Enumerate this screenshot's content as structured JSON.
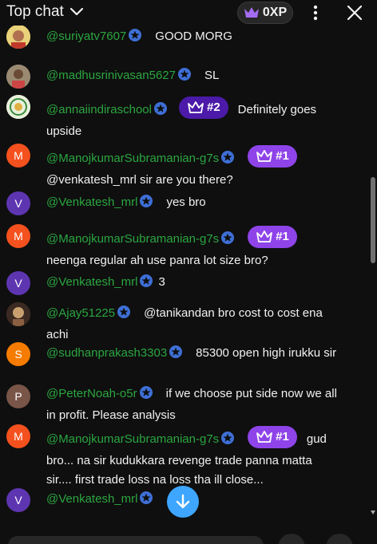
{
  "header": {
    "title": "Top chat",
    "xp_label": "0XP"
  },
  "colors": {
    "author": "#2ba640",
    "badge_primary": "#8e44e9",
    "badge_secondary": "#4b1aa8",
    "accent": "#3ea6ff"
  },
  "messages": [
    {
      "author": "@suriyatv7607",
      "text": "GOOD MORG",
      "avatar_letter": ""
    },
    {
      "author": "@madhusrinivasan5627",
      "text": "SL",
      "avatar_letter": ""
    },
    {
      "author": "@annaiindiraschool",
      "badge": "#2",
      "text": "Definitely goes upside",
      "avatar_letter": ""
    },
    {
      "author": "@ManojkumarSubramanian-g7s",
      "badge": "#1",
      "text": "@venkatesh_mrl sir are you there?",
      "avatar_letter": "M"
    },
    {
      "author": "@Venkatesh_mrl",
      "text": "yes bro",
      "avatar_letter": "V"
    },
    {
      "author": "@ManojkumarSubramanian-g7s",
      "badge": "#1",
      "text": "neenga regular ah use panra lot size bro?",
      "avatar_letter": "M"
    },
    {
      "author": "@Venkatesh_mrl",
      "text": "3",
      "avatar_letter": "V"
    },
    {
      "author": "@Ajay51225",
      "text": "@tanikandan bro cost to cost ena achi",
      "avatar_letter": ""
    },
    {
      "author": "@sudhanprakash3303",
      "text": "85300 open high irukku sir",
      "avatar_letter": "S"
    },
    {
      "author": "@PeterNoah-o5r",
      "text": "if we choose put side now we all in profit. Please analysis",
      "avatar_letter": "P"
    },
    {
      "author": "@ManojkumarSubramanian-g7s",
      "badge": "#1",
      "text": "gud bro... na sir kudukkara revenge trade panna matta sir.... first trade loss na loss tha ill close...",
      "avatar_letter": "M"
    },
    {
      "author": "@Venkatesh_mrl",
      "text": "",
      "avatar_letter": "V"
    }
  ]
}
